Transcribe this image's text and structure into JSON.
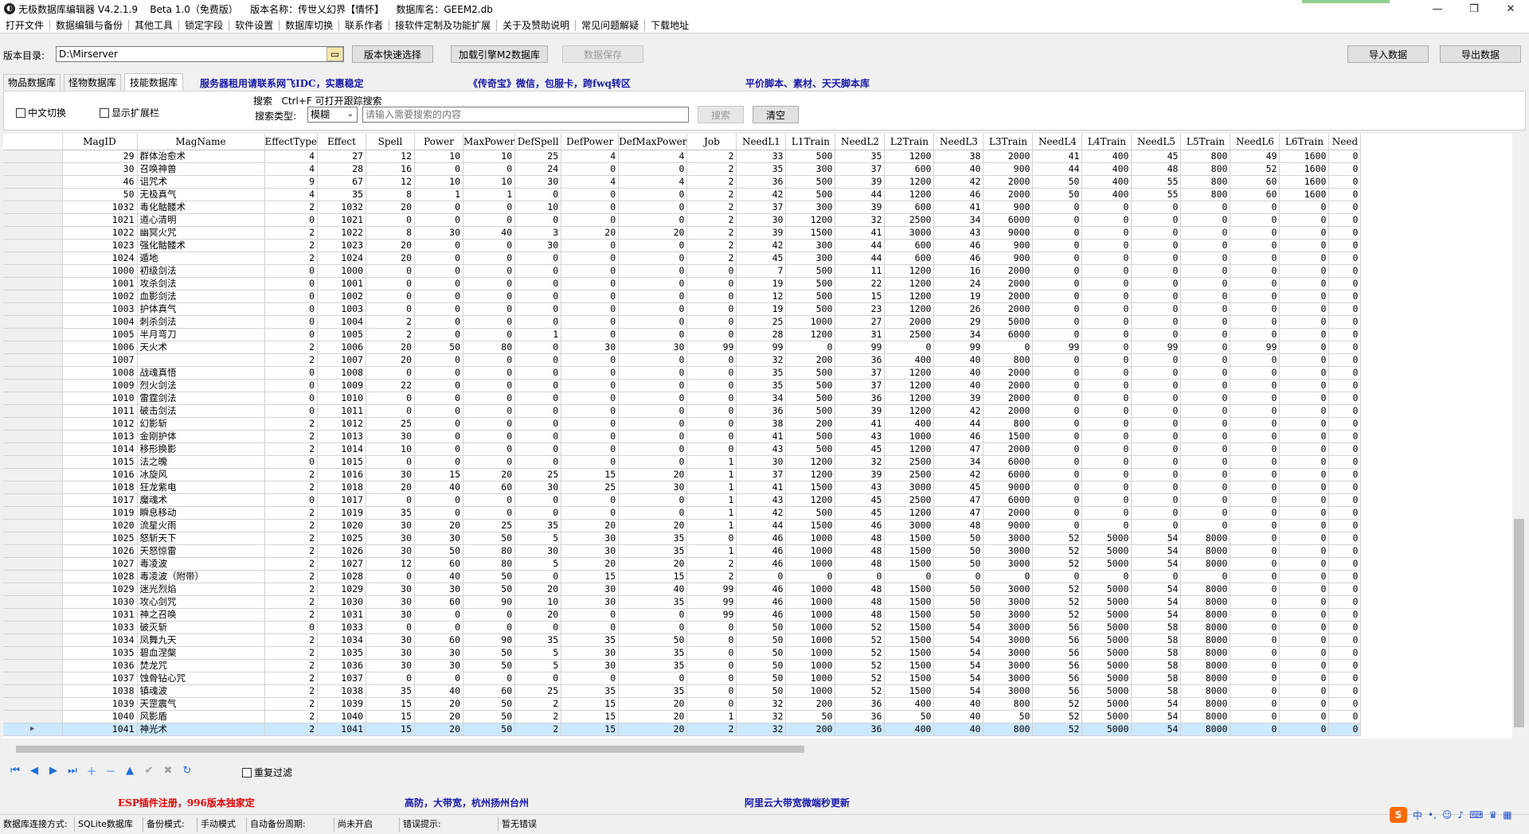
{
  "window": {
    "title": "无极数据库编辑器 V4.2.1.9    Beta 1.0（免费版）    版本名称：传世乂幻界【情怀】    数据库名：GEEM2.db",
    "minimize": "—",
    "maximize": "❐",
    "close": "✕"
  },
  "menu": [
    "打开文件",
    "数据编辑与备份",
    "其他工具",
    "锁定字段",
    "软件设置",
    "数据库切换",
    "联系作者",
    "接软件定制及功能扩展",
    "关于及赞助说明",
    "常见问题解疑",
    "下载地址"
  ],
  "toolbar": {
    "dir_label": "版本目录:",
    "dir_value": "D:\\Mirserver",
    "quick_select": "版本快速选择",
    "load_engine": "加载引擎M2数据库",
    "save_data": "数据保存",
    "import": "导入数据",
    "export": "导出数据"
  },
  "tabs": [
    "物品数据库",
    "怪物数据库",
    "技能数据库"
  ],
  "ads_top": [
    "服务器租用请联系网飞IDC，实惠稳定",
    "《传奇宝》微信，包服卡，跨fwq转区",
    "平价脚本、素材、天天脚本库"
  ],
  "options": {
    "cn_switch": "中文切换",
    "show_ext": "显示扩展栏",
    "search_hint": "搜索   Ctrl+F 可打开跟踪搜索",
    "search_type_label": "搜索类型:",
    "search_type_value": "模糊",
    "search_placeholder": "请输入需要搜索的内容",
    "search_btn": "搜索",
    "clear_btn": "清空"
  },
  "grid": {
    "columns": [
      "MagID",
      "MagName",
      "EffectType",
      "Effect",
      "Spell",
      "Power",
      "MaxPower",
      "DefSpell",
      "DefPower",
      "DefMaxPower",
      "Job",
      "NeedL1",
      "L1Train",
      "NeedL2",
      "L2Train",
      "NeedL3",
      "L3Train",
      "NeedL4",
      "L4Train",
      "NeedL5",
      "L5Train",
      "NeedL6",
      "L6Train",
      "Need"
    ],
    "rows": [
      [
        "29",
        "群体治愈术",
        "4",
        "27",
        "12",
        "10",
        "10",
        "25",
        "4",
        "4",
        "2",
        "33",
        "500",
        "35",
        "1200",
        "38",
        "2000",
        "41",
        "400",
        "45",
        "800",
        "49",
        "1600",
        "0"
      ],
      [
        "30",
        "召唤神兽",
        "4",
        "28",
        "16",
        "0",
        "0",
        "24",
        "0",
        "0",
        "2",
        "35",
        "300",
        "37",
        "600",
        "40",
        "900",
        "44",
        "400",
        "48",
        "800",
        "52",
        "1600",
        "0"
      ],
      [
        "46",
        "诅咒术",
        "9",
        "67",
        "12",
        "10",
        "10",
        "30",
        "4",
        "4",
        "2",
        "36",
        "500",
        "39",
        "1200",
        "42",
        "2000",
        "50",
        "400",
        "55",
        "800",
        "60",
        "1600",
        "0"
      ],
      [
        "50",
        "无极真气",
        "4",
        "35",
        "8",
        "1",
        "1",
        "0",
        "0",
        "0",
        "2",
        "42",
        "500",
        "44",
        "1200",
        "46",
        "2000",
        "50",
        "400",
        "55",
        "800",
        "60",
        "1600",
        "0"
      ],
      [
        "1032",
        "毒化骷髅术",
        "2",
        "1032",
        "20",
        "0",
        "0",
        "10",
        "0",
        "0",
        "2",
        "37",
        "300",
        "39",
        "600",
        "41",
        "900",
        "0",
        "0",
        "0",
        "0",
        "0",
        "0",
        "0"
      ],
      [
        "1021",
        "道心清明",
        "0",
        "1021",
        "0",
        "0",
        "0",
        "0",
        "0",
        "0",
        "2",
        "30",
        "1200",
        "32",
        "2500",
        "34",
        "6000",
        "0",
        "0",
        "0",
        "0",
        "0",
        "0",
        "0"
      ],
      [
        "1022",
        "幽冥火咒",
        "2",
        "1022",
        "8",
        "30",
        "40",
        "3",
        "20",
        "20",
        "2",
        "39",
        "1500",
        "41",
        "3000",
        "43",
        "9000",
        "0",
        "0",
        "0",
        "0",
        "0",
        "0",
        "0"
      ],
      [
        "1023",
        "强化骷髅术",
        "2",
        "1023",
        "20",
        "0",
        "0",
        "30",
        "0",
        "0",
        "2",
        "42",
        "300",
        "44",
        "600",
        "46",
        "900",
        "0",
        "0",
        "0",
        "0",
        "0",
        "0",
        "0"
      ],
      [
        "1024",
        "遁地",
        "2",
        "1024",
        "20",
        "0",
        "0",
        "0",
        "0",
        "0",
        "2",
        "45",
        "300",
        "44",
        "600",
        "46",
        "900",
        "0",
        "0",
        "0",
        "0",
        "0",
        "0",
        "0"
      ],
      [
        "1000",
        "初级剑法",
        "0",
        "1000",
        "0",
        "0",
        "0",
        "0",
        "0",
        "0",
        "0",
        "7",
        "500",
        "11",
        "1200",
        "16",
        "2000",
        "0",
        "0",
        "0",
        "0",
        "0",
        "0",
        "0"
      ],
      [
        "1001",
        "攻杀剑法",
        "0",
        "1001",
        "0",
        "0",
        "0",
        "0",
        "0",
        "0",
        "0",
        "19",
        "500",
        "22",
        "1200",
        "24",
        "2000",
        "0",
        "0",
        "0",
        "0",
        "0",
        "0",
        "0"
      ],
      [
        "1002",
        "血影剑法",
        "0",
        "1002",
        "0",
        "0",
        "0",
        "0",
        "0",
        "0",
        "0",
        "12",
        "500",
        "15",
        "1200",
        "19",
        "2000",
        "0",
        "0",
        "0",
        "0",
        "0",
        "0",
        "0"
      ],
      [
        "1003",
        "护体真气",
        "0",
        "1003",
        "0",
        "0",
        "0",
        "0",
        "0",
        "0",
        "0",
        "19",
        "500",
        "23",
        "1200",
        "26",
        "2000",
        "0",
        "0",
        "0",
        "0",
        "0",
        "0",
        "0"
      ],
      [
        "1004",
        "刺杀剑法",
        "0",
        "1004",
        "2",
        "0",
        "0",
        "0",
        "0",
        "0",
        "0",
        "25",
        "1000",
        "27",
        "2000",
        "29",
        "5000",
        "0",
        "0",
        "0",
        "0",
        "0",
        "0",
        "0"
      ],
      [
        "1005",
        "半月弯刀",
        "0",
        "1005",
        "2",
        "0",
        "0",
        "1",
        "0",
        "0",
        "0",
        "28",
        "1200",
        "31",
        "2500",
        "34",
        "6000",
        "0",
        "0",
        "0",
        "0",
        "0",
        "0",
        "0"
      ],
      [
        "1006",
        "天火术",
        "2",
        "1006",
        "20",
        "50",
        "80",
        "0",
        "30",
        "30",
        "99",
        "99",
        "0",
        "99",
        "0",
        "99",
        "0",
        "99",
        "0",
        "99",
        "0",
        "99",
        "0",
        "0"
      ],
      [
        "1007",
        "",
        "2",
        "1007",
        "20",
        "0",
        "0",
        "0",
        "0",
        "0",
        "0",
        "32",
        "200",
        "36",
        "400",
        "40",
        "800",
        "0",
        "0",
        "0",
        "0",
        "0",
        "0",
        "0"
      ],
      [
        "1008",
        "战魂真悟",
        "0",
        "1008",
        "0",
        "0",
        "0",
        "0",
        "0",
        "0",
        "0",
        "35",
        "500",
        "37",
        "1200",
        "40",
        "2000",
        "0",
        "0",
        "0",
        "0",
        "0",
        "0",
        "0"
      ],
      [
        "1009",
        "烈火剑法",
        "0",
        "1009",
        "22",
        "0",
        "0",
        "0",
        "0",
        "0",
        "0",
        "35",
        "500",
        "37",
        "1200",
        "40",
        "2000",
        "0",
        "0",
        "0",
        "0",
        "0",
        "0",
        "0"
      ],
      [
        "1010",
        "雷霆剑法",
        "0",
        "1010",
        "0",
        "0",
        "0",
        "0",
        "0",
        "0",
        "0",
        "34",
        "500",
        "36",
        "1200",
        "39",
        "2000",
        "0",
        "0",
        "0",
        "0",
        "0",
        "0",
        "0"
      ],
      [
        "1011",
        "破击剑法",
        "0",
        "1011",
        "0",
        "0",
        "0",
        "0",
        "0",
        "0",
        "0",
        "36",
        "500",
        "39",
        "1200",
        "42",
        "2000",
        "0",
        "0",
        "0",
        "0",
        "0",
        "0",
        "0"
      ],
      [
        "1012",
        "幻影斩",
        "2",
        "1012",
        "25",
        "0",
        "0",
        "0",
        "0",
        "0",
        "0",
        "38",
        "200",
        "41",
        "400",
        "44",
        "800",
        "0",
        "0",
        "0",
        "0",
        "0",
        "0",
        "0"
      ],
      [
        "1013",
        "金刚护体",
        "2",
        "1013",
        "30",
        "0",
        "0",
        "0",
        "0",
        "0",
        "0",
        "41",
        "500",
        "43",
        "1000",
        "46",
        "1500",
        "0",
        "0",
        "0",
        "0",
        "0",
        "0",
        "0"
      ],
      [
        "1014",
        "移形换影",
        "2",
        "1014",
        "10",
        "0",
        "0",
        "0",
        "0",
        "0",
        "0",
        "43",
        "500",
        "45",
        "1200",
        "47",
        "2000",
        "0",
        "0",
        "0",
        "0",
        "0",
        "0",
        "0"
      ],
      [
        "1015",
        "法之魄",
        "0",
        "1015",
        "0",
        "0",
        "0",
        "0",
        "0",
        "0",
        "1",
        "30",
        "1200",
        "32",
        "2500",
        "34",
        "6000",
        "0",
        "0",
        "0",
        "0",
        "0",
        "0",
        "0"
      ],
      [
        "1016",
        "冰旋风",
        "2",
        "1016",
        "30",
        "15",
        "20",
        "25",
        "15",
        "20",
        "1",
        "37",
        "1200",
        "39",
        "2500",
        "42",
        "6000",
        "0",
        "0",
        "0",
        "0",
        "0",
        "0",
        "0"
      ],
      [
        "1018",
        "狂龙紫电",
        "2",
        "1018",
        "20",
        "40",
        "60",
        "30",
        "25",
        "30",
        "1",
        "41",
        "1500",
        "43",
        "3000",
        "45",
        "9000",
        "0",
        "0",
        "0",
        "0",
        "0",
        "0",
        "0"
      ],
      [
        "1017",
        "魔魂术",
        "0",
        "1017",
        "0",
        "0",
        "0",
        "0",
        "0",
        "0",
        "1",
        "43",
        "1200",
        "45",
        "2500",
        "47",
        "6000",
        "0",
        "0",
        "0",
        "0",
        "0",
        "0",
        "0"
      ],
      [
        "1019",
        "瞬息移动",
        "2",
        "1019",
        "35",
        "0",
        "0",
        "0",
        "0",
        "0",
        "1",
        "42",
        "500",
        "45",
        "1200",
        "47",
        "2000",
        "0",
        "0",
        "0",
        "0",
        "0",
        "0",
        "0"
      ],
      [
        "1020",
        "流星火雨",
        "2",
        "1020",
        "30",
        "20",
        "25",
        "35",
        "20",
        "20",
        "1",
        "44",
        "1500",
        "46",
        "3000",
        "48",
        "9000",
        "0",
        "0",
        "0",
        "0",
        "0",
        "0",
        "0"
      ],
      [
        "1025",
        "怒斩天下",
        "2",
        "1025",
        "30",
        "30",
        "50",
        "5",
        "30",
        "35",
        "0",
        "46",
        "1000",
        "48",
        "1500",
        "50",
        "3000",
        "52",
        "5000",
        "54",
        "8000",
        "0",
        "0",
        "0"
      ],
      [
        "1026",
        "天怒惊雷",
        "2",
        "1026",
        "30",
        "50",
        "80",
        "30",
        "30",
        "35",
        "1",
        "46",
        "1000",
        "48",
        "1500",
        "50",
        "3000",
        "52",
        "5000",
        "54",
        "8000",
        "0",
        "0",
        "0"
      ],
      [
        "1027",
        "毒凌波",
        "2",
        "1027",
        "12",
        "60",
        "80",
        "5",
        "20",
        "20",
        "2",
        "46",
        "1000",
        "48",
        "1500",
        "50",
        "3000",
        "52",
        "5000",
        "54",
        "8000",
        "0",
        "0",
        "0"
      ],
      [
        "1028",
        "毒凌波（附带）",
        "2",
        "1028",
        "0",
        "40",
        "50",
        "0",
        "15",
        "15",
        "2",
        "0",
        "0",
        "0",
        "0",
        "0",
        "0",
        "0",
        "0",
        "0",
        "0",
        "0",
        "0",
        "0"
      ],
      [
        "1029",
        "迷光烈焰",
        "2",
        "1029",
        "30",
        "30",
        "50",
        "20",
        "30",
        "40",
        "99",
        "46",
        "1000",
        "48",
        "1500",
        "50",
        "3000",
        "52",
        "5000",
        "54",
        "8000",
        "0",
        "0",
        "0"
      ],
      [
        "1030",
        "攻心剑咒",
        "2",
        "1030",
        "30",
        "60",
        "90",
        "10",
        "30",
        "35",
        "99",
        "46",
        "1000",
        "48",
        "1500",
        "50",
        "3000",
        "52",
        "5000",
        "54",
        "8000",
        "0",
        "0",
        "0"
      ],
      [
        "1031",
        "神之召唤",
        "2",
        "1031",
        "30",
        "0",
        "0",
        "20",
        "0",
        "0",
        "99",
        "46",
        "1000",
        "48",
        "1500",
        "50",
        "3000",
        "52",
        "5000",
        "54",
        "8000",
        "0",
        "0",
        "0"
      ],
      [
        "1033",
        "破灭斩",
        "0",
        "1033",
        "0",
        "0",
        "0",
        "0",
        "0",
        "0",
        "0",
        "50",
        "1000",
        "52",
        "1500",
        "54",
        "3000",
        "56",
        "5000",
        "58",
        "8000",
        "0",
        "0",
        "0"
      ],
      [
        "1034",
        "凤舞九天",
        "2",
        "1034",
        "30",
        "60",
        "90",
        "35",
        "35",
        "50",
        "0",
        "50",
        "1000",
        "52",
        "1500",
        "54",
        "3000",
        "56",
        "5000",
        "58",
        "8000",
        "0",
        "0",
        "0"
      ],
      [
        "1035",
        "碧血涅槃",
        "2",
        "1035",
        "30",
        "30",
        "50",
        "5",
        "30",
        "35",
        "0",
        "50",
        "1000",
        "52",
        "1500",
        "54",
        "3000",
        "56",
        "5000",
        "58",
        "8000",
        "0",
        "0",
        "0"
      ],
      [
        "1036",
        "焚龙咒",
        "2",
        "1036",
        "30",
        "30",
        "50",
        "5",
        "30",
        "35",
        "0",
        "50",
        "1000",
        "52",
        "1500",
        "54",
        "3000",
        "56",
        "5000",
        "58",
        "8000",
        "0",
        "0",
        "0"
      ],
      [
        "1037",
        "蚀骨钻心咒",
        "2",
        "1037",
        "0",
        "0",
        "0",
        "0",
        "0",
        "0",
        "0",
        "50",
        "1000",
        "52",
        "1500",
        "54",
        "3000",
        "56",
        "5000",
        "58",
        "8000",
        "0",
        "0",
        "0"
      ],
      [
        "1038",
        "镇魂波",
        "2",
        "1038",
        "35",
        "40",
        "60",
        "25",
        "35",
        "35",
        "0",
        "50",
        "1000",
        "52",
        "1500",
        "54",
        "3000",
        "56",
        "5000",
        "58",
        "8000",
        "0",
        "0",
        "0"
      ],
      [
        "1039",
        "天罡震气",
        "2",
        "1039",
        "15",
        "20",
        "50",
        "2",
        "15",
        "20",
        "0",
        "32",
        "200",
        "36",
        "400",
        "40",
        "800",
        "52",
        "5000",
        "54",
        "8000",
        "0",
        "0",
        "0"
      ],
      [
        "1040",
        "风影盾",
        "2",
        "1040",
        "15",
        "20",
        "50",
        "2",
        "15",
        "20",
        "1",
        "32",
        "50",
        "36",
        "50",
        "40",
        "50",
        "52",
        "5000",
        "54",
        "8000",
        "0",
        "0",
        "0"
      ],
      [
        "1041",
        "神光术",
        "2",
        "1041",
        "15",
        "20",
        "50",
        "2",
        "15",
        "20",
        "2",
        "32",
        "200",
        "36",
        "400",
        "40",
        "800",
        "52",
        "5000",
        "54",
        "8000",
        "0",
        "0",
        "0"
      ]
    ]
  },
  "filter": {
    "repeat_filter": "重复过滤"
  },
  "ads_bottom": [
    "ESP插件注册，996版本独家定",
    "高防，大带宽，杭州扬州台州",
    "阿里云大带宽微端秒更新"
  ],
  "status": [
    "数据库连接方式:",
    "SQLite数据库",
    "备份模式:",
    "手动模式",
    "自动备份周期:",
    "尚未开启",
    "错误提示:",
    "暂无错误"
  ],
  "ime": {
    "logo": "S",
    "lang": "中"
  }
}
